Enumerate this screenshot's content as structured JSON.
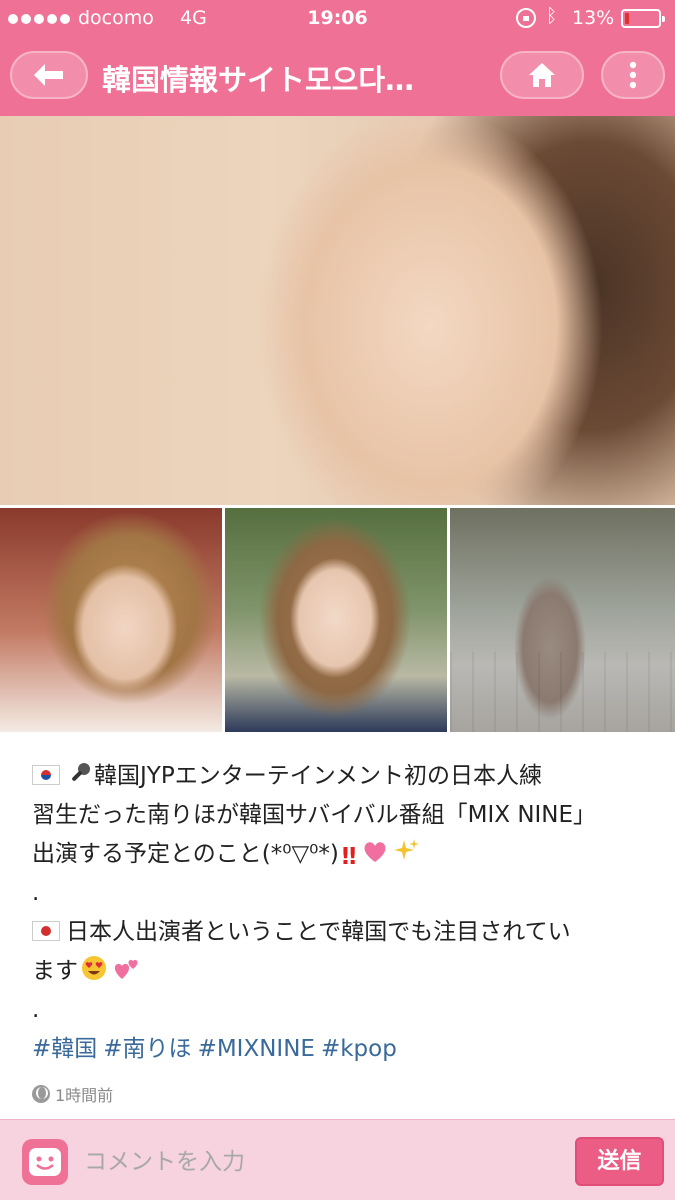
{
  "status_bar": {
    "carrier": "docomo",
    "network": "4G",
    "time": "19:06",
    "battery_percent_text": "13%",
    "battery_level": 0.13,
    "battery_color": "#e03030"
  },
  "navbar": {
    "title": "韓国情報サイト모으다…",
    "back_icon": "back-arrow-icon",
    "home_icon": "home-icon",
    "more_icon": "more-vertical-icon",
    "accent_color": "#ef7196"
  },
  "post": {
    "lines": [
      "韓国JYPエンターテインメント初の日本人練",
      "習生だった南りほが韓国サバイバル番組「MIX NINE」",
      "出演する予定とのこと(*⁰▽⁰*)",
      ".",
      "日本人出演者ということで韓国でも注目されてい",
      "ます",
      "."
    ],
    "hashtags": [
      "#韓国",
      "#南りほ",
      "#MIXNINE",
      "#kpop"
    ],
    "timestamp": "1時間前",
    "hashtag_color": "#3a6a9a"
  },
  "comment_bar": {
    "placeholder": "コメントを入力",
    "send_label": "送信",
    "sticker_icon": "smiley-face-icon"
  }
}
